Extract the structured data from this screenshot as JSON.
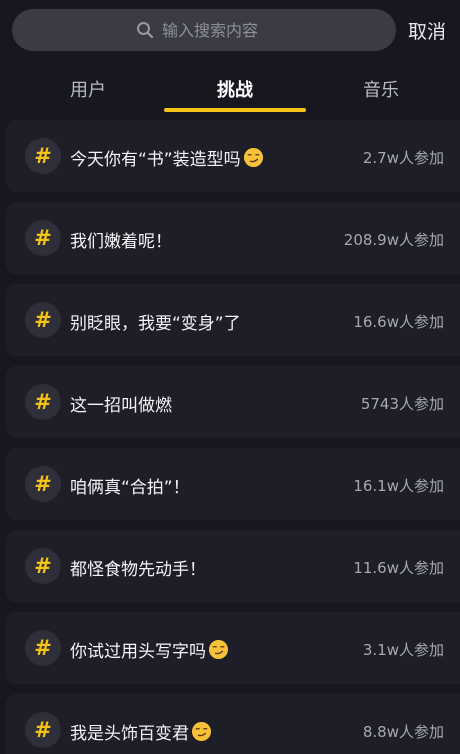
{
  "search": {
    "placeholder": "输入搜索内容",
    "cancel_label": "取消"
  },
  "tabs": [
    {
      "label": "用户",
      "active": false
    },
    {
      "label": "挑战",
      "active": true
    },
    {
      "label": "音乐",
      "active": false
    }
  ],
  "colors": {
    "accent": "#f6c417",
    "background": "#16171f",
    "card": "#1d1e27"
  },
  "icons": {
    "search": "search-icon",
    "hashtag": "hashtag-icon",
    "emoji": "smirk-emoji-icon"
  },
  "challenges": [
    {
      "title": "今天你有“书”装造型吗",
      "emoji": true,
      "count": "2.7w人参加"
    },
    {
      "title": "我们嫩着呢！",
      "emoji": false,
      "count": "208.9w人参加"
    },
    {
      "title": "别眨眼，我要“变身”了",
      "emoji": false,
      "count": "16.6w人参加"
    },
    {
      "title": "这一招叫做燃",
      "emoji": false,
      "count": "5743人参加"
    },
    {
      "title": "咱俩真“合拍”！",
      "emoji": false,
      "count": "16.1w人参加"
    },
    {
      "title": "都怪食物先动手！",
      "emoji": false,
      "count": "11.6w人参加"
    },
    {
      "title": "你试过用头写字吗",
      "emoji": true,
      "count": "3.1w人参加"
    },
    {
      "title": "我是头饰百变君",
      "emoji": true,
      "count": "8.8w人参加"
    }
  ]
}
